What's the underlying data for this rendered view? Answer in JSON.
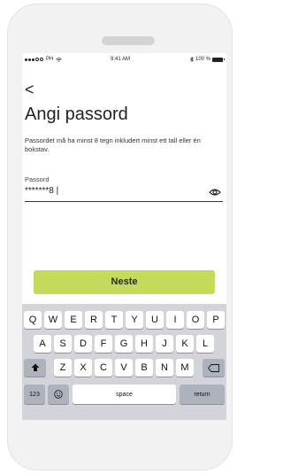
{
  "status_bar": {
    "carrier": "PH",
    "time": "9:41 AM",
    "battery": "100 %"
  },
  "nav": {
    "back_icon": "chevron-left-icon",
    "back_glyph": "<"
  },
  "page": {
    "title": "Angi passord",
    "description": "Passordet må ha minst 8 tegn inkludert minst ett tall eller én bokstav."
  },
  "password_field": {
    "label": "Passord",
    "value": "*******8 |",
    "toggle_icon": "eye-icon"
  },
  "next_button": {
    "label": "Neste",
    "color": "#c3da5a"
  },
  "keyboard": {
    "row1": [
      "Q",
      "W",
      "E",
      "R",
      "T",
      "Y",
      "U",
      "I",
      "O",
      "P"
    ],
    "row2": [
      "A",
      "S",
      "D",
      "F",
      "G",
      "H",
      "J",
      "K",
      "L"
    ],
    "row3": [
      "Z",
      "X",
      "C",
      "V",
      "B",
      "N",
      "M"
    ],
    "shift_icon": "shift-icon",
    "delete_icon": "backspace-icon",
    "numbers_label": "123",
    "emoji_icon": "emoji-icon",
    "space_label": "space",
    "return_label": "return"
  }
}
